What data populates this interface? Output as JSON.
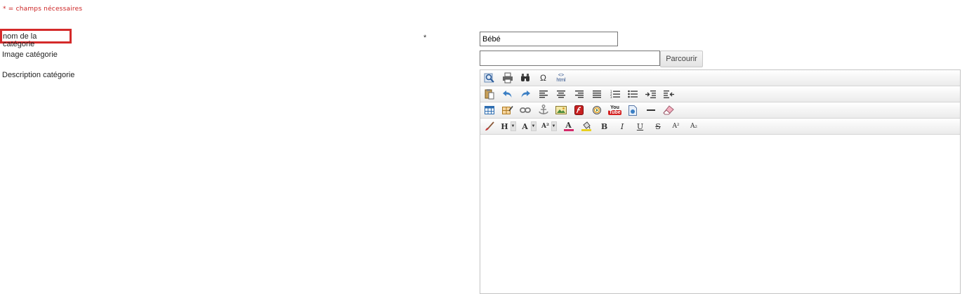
{
  "form": {
    "required_note": "* = champs nécessaires",
    "name_label": "nom de la catégorie",
    "image_label": "Image catégorie",
    "description_label": "Description catégorie",
    "required_marker": "*",
    "name_value": "Bébé",
    "image_value": "",
    "browse_label": "Parcourir"
  },
  "editor": {
    "toolbar_rows": [
      [
        "preview",
        "print",
        "find",
        "special-characters",
        "html-source"
      ],
      [
        "paste-word",
        "undo",
        "redo",
        "align-left",
        "align-center",
        "align-right",
        "justify",
        "ordered-list",
        "unordered-list",
        "indent",
        "outdent"
      ],
      [
        "table",
        "table-edit",
        "link",
        "anchor",
        "image",
        "flash",
        "media",
        "youtube",
        "file",
        "horizontal-rule",
        "eraser"
      ],
      [
        "brush",
        "heading",
        "font",
        "font-size",
        "font-color",
        "highlight-color",
        "bold",
        "italic",
        "underline",
        "strikethrough",
        "superscript",
        "subscript"
      ]
    ],
    "glyphs": {
      "special_characters": "Ω",
      "html_top": "<>",
      "html_bottom": "html",
      "heading": "H",
      "font": "A",
      "font_size": "A²",
      "font_color": "A",
      "bold": "B",
      "italic": "I",
      "underline": "U",
      "strikethrough": "S",
      "superscript": "A²",
      "subscript": "A₂",
      "youtube_top": "You",
      "youtube_bottom": "Tube"
    },
    "colors": {
      "accent_blue": "#3b7fc4",
      "youtube_red": "#d42020",
      "font_color_bar": "#d42a6a",
      "highlight_bar": "#e8d020"
    }
  }
}
